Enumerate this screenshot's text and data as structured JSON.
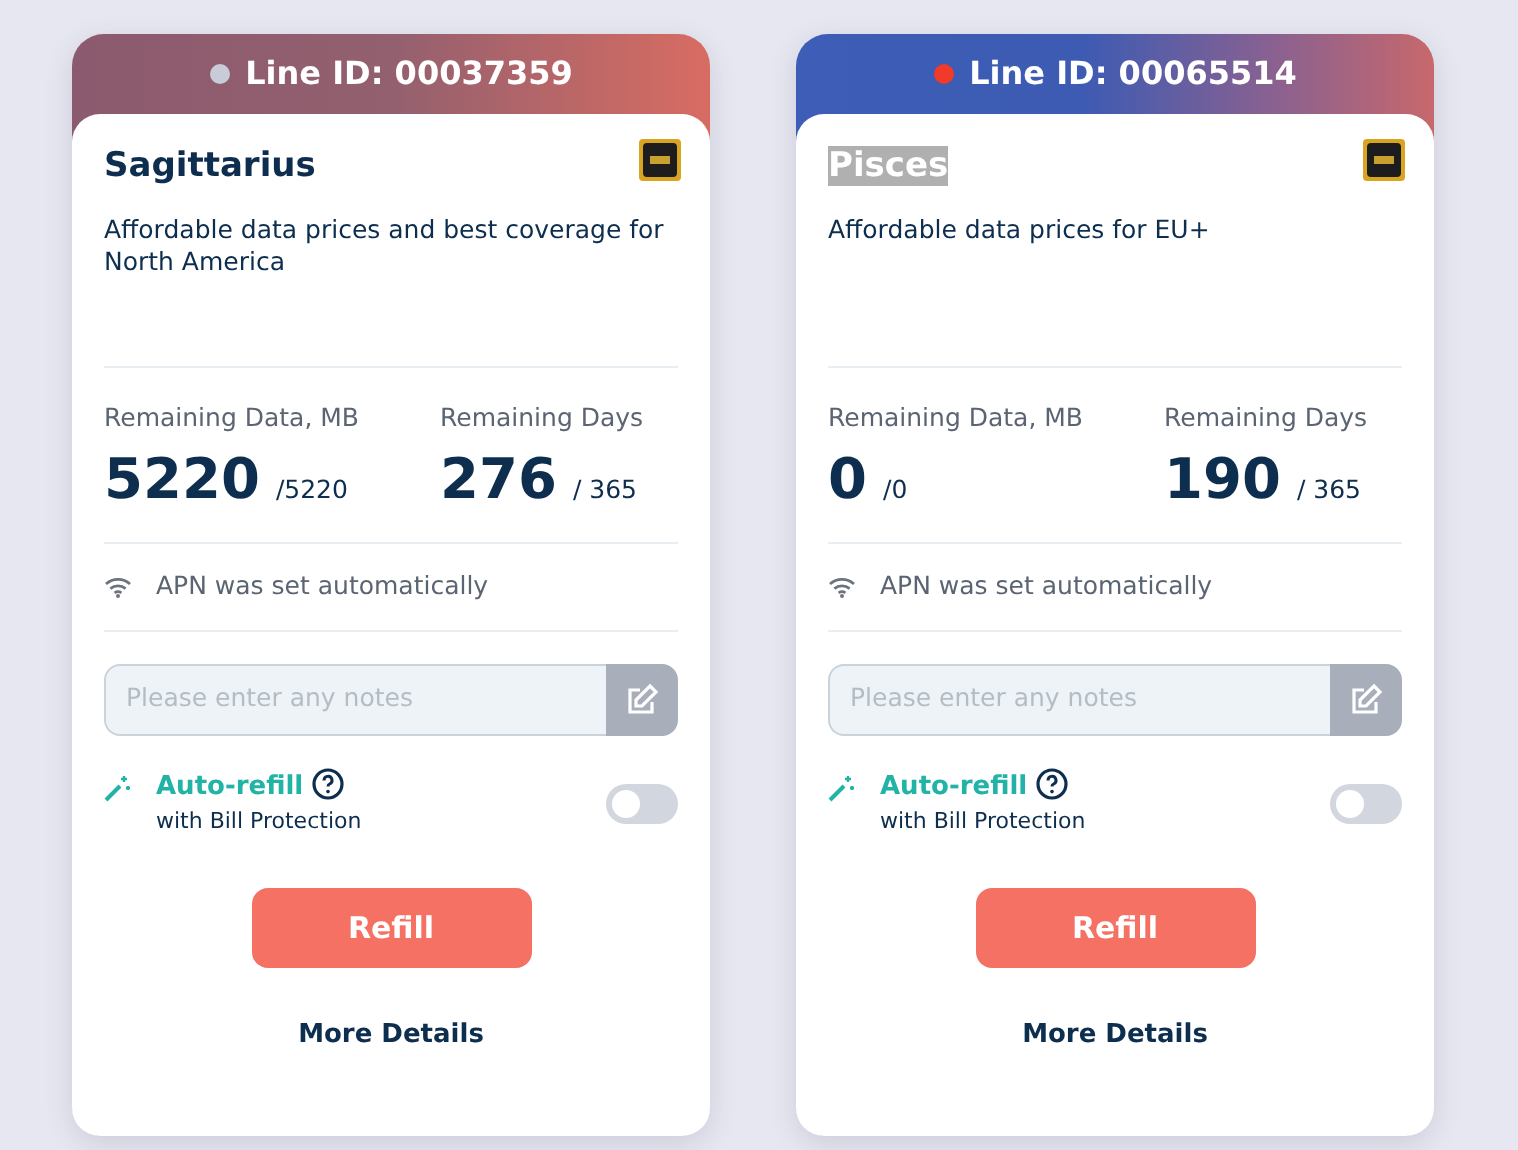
{
  "cards": [
    {
      "kind": "rose",
      "line_id": "Line ID: 00037359",
      "color": "#c8ccd6",
      "name": "Sagittarius",
      "name_highlighted": false,
      "description": "Affordable data prices and best coverage for North America",
      "data_label": "Remaining Data, MB",
      "data_value": "5220",
      "data_total": "/5220",
      "days_label": "Remaining Days",
      "days_value": "276",
      "days_total": "/ 365",
      "apn": "APN was set automatically",
      "notes_placeholder": "Please enter any notes",
      "autorefill_label": "Auto-refill",
      "autorefill_sub": "with Bill Protection",
      "autorefill_on": false,
      "refill_button": "Refill",
      "more_link": "More Details"
    },
    {
      "kind": "blue",
      "line_id": "Line ID: 00065514",
      "color": "#f03a2a",
      "name": "Pisces",
      "name_highlighted": true,
      "description": "Affordable data prices for EU+",
      "data_label": "Remaining Data, MB",
      "data_value": "0",
      "data_total": "/0",
      "days_label": "Remaining Days",
      "days_value": "190",
      "days_total": "/ 365",
      "apn": "APN was set automatically",
      "notes_placeholder": "Please enter any notes",
      "autorefill_label": "Auto-refill",
      "autorefill_sub": "with Bill Protection",
      "autorefill_on": false,
      "refill_button": "Refill",
      "more_link": "More Details"
    }
  ]
}
